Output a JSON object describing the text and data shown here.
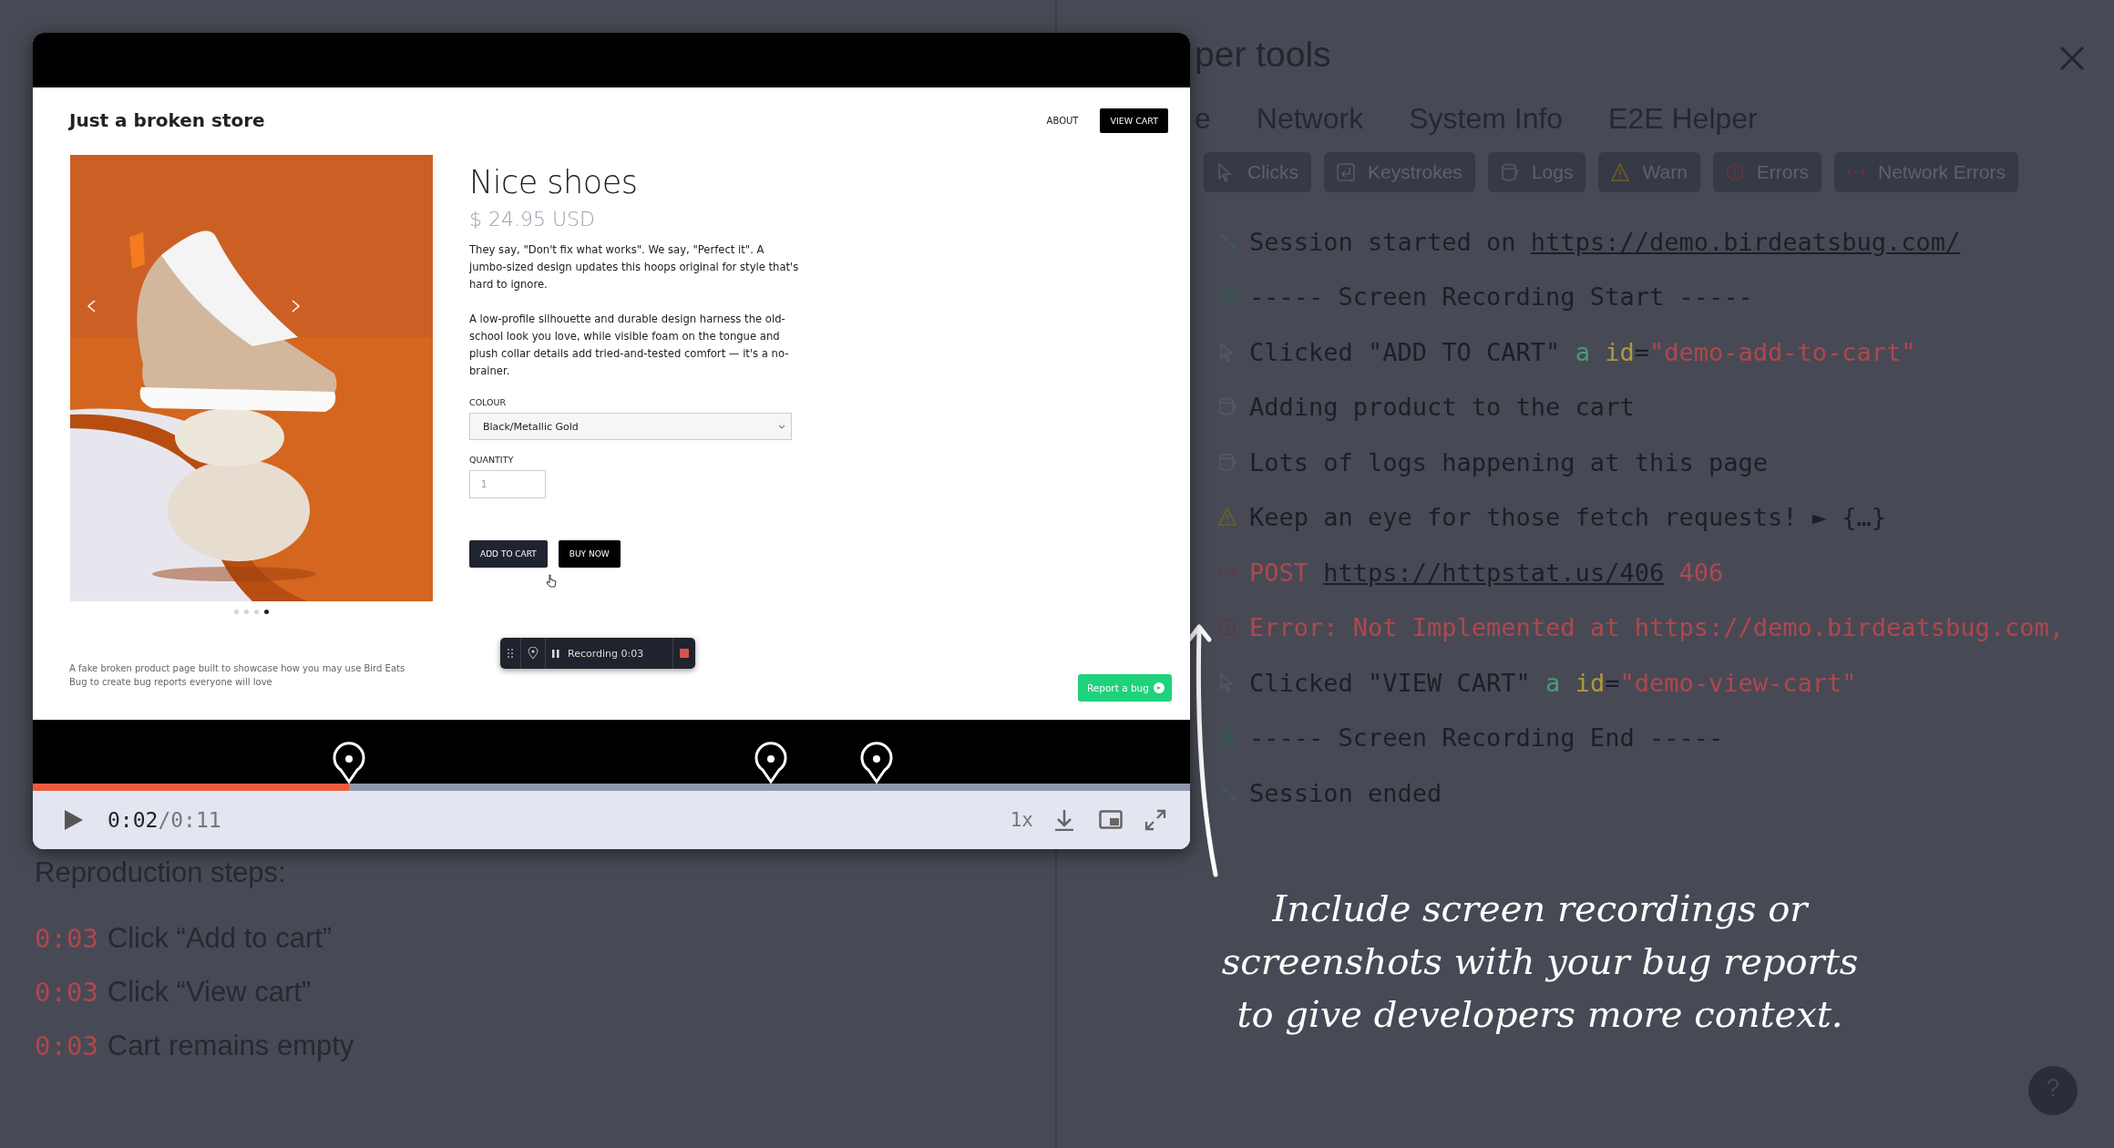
{
  "video": {
    "store": {
      "title": "Just a broken store",
      "nav": [
        {
          "label": "ABOUT",
          "kind": "link"
        },
        {
          "label": "VIEW CART",
          "kind": "button"
        }
      ],
      "product": {
        "name": "Nice shoes",
        "price": "$ 24.95 USD",
        "paragraphs": [
          "They say, \"Don't fix what works\". We say, \"Perfect it\". A jumbo-sized design updates this hoops original for style that's hard to ignore.",
          "A low-profile silhouette and durable design harness the old-school look you love, while visible foam on the tongue and plush collar details add tried-and-tested comfort — it's a no-brainer."
        ],
        "colour_label": "COLOUR",
        "colour_value": "Black/Metallic Gold",
        "quantity_label": "QUANTITY",
        "quantity_value": "1",
        "buttons": [
          {
            "label": "ADD TO CART",
            "kind": "secondary"
          },
          {
            "label": "BUY NOW",
            "kind": "primary"
          }
        ]
      },
      "carousel_dots": [
        {
          "selected": false
        },
        {
          "selected": false
        },
        {
          "selected": false
        },
        {
          "selected": true
        }
      ],
      "footer": "A fake broken product page built to showcase how you may use Bird Eats Bug to create bug reports everyone will love",
      "recorder": {
        "label": "Recording 0:03"
      },
      "report_button": "Report a bug"
    },
    "progress": {
      "level": 0.273
    },
    "time_current": "0:02",
    "time_total": "/0:11",
    "speed": "1x"
  },
  "left": {
    "heading": "Reproduction steps:",
    "steps": [
      {
        "time": "0:03",
        "text": "Click “Add to cart”"
      },
      {
        "time": "0:03",
        "text": "Click “View cart”"
      },
      {
        "time": "0:03",
        "text": "Cart remains empty"
      }
    ]
  },
  "dev_tools": {
    "title": "per tools",
    "tabs": [
      {
        "label": "e"
      },
      {
        "label": "Network"
      },
      {
        "label": "System Info"
      },
      {
        "label": "E2E Helper"
      }
    ],
    "filters": [
      {
        "label": "Clicks",
        "kind": "click"
      },
      {
        "label": "Keystrokes",
        "kind": "key"
      },
      {
        "label": "Logs",
        "kind": "log"
      },
      {
        "label": "Warn",
        "kind": "warn"
      },
      {
        "label": "Errors",
        "kind": "error"
      },
      {
        "label": "Network Errors",
        "kind": "network"
      }
    ],
    "logs": [
      {
        "kind": "session",
        "parts": [
          {
            "text": "Session started on ",
            "kind": "plain"
          },
          {
            "text": "https://demo.birdeatsbug.com/",
            "kind": "link"
          }
        ]
      },
      {
        "kind": "rec-start",
        "parts": [
          {
            "text": "----- Screen Recording Start -----",
            "kind": "plain"
          }
        ]
      },
      {
        "kind": "click",
        "parts": [
          {
            "text": "Clicked \"ADD TO CART\" ",
            "kind": "plain"
          },
          {
            "text": "a ",
            "kind": "tag"
          },
          {
            "text": "id",
            "kind": "attr"
          },
          {
            "text": "=",
            "kind": "plain"
          },
          {
            "text": "\"demo-add-to-cart\"",
            "kind": "string"
          }
        ]
      },
      {
        "kind": "log",
        "parts": [
          {
            "text": "Adding product to the cart",
            "kind": "plain"
          }
        ]
      },
      {
        "kind": "log",
        "parts": [
          {
            "text": "Lots of logs happening at this page",
            "kind": "plain"
          }
        ]
      },
      {
        "kind": "warn",
        "parts": [
          {
            "text": "Keep an eye for those fetch requests! ► {…}",
            "kind": "plain"
          }
        ]
      },
      {
        "kind": "network",
        "parts": [
          {
            "text": "POST ",
            "kind": "error"
          },
          {
            "text": "https://httpstat.us/406",
            "kind": "link"
          },
          {
            "text": " 406",
            "kind": "error"
          }
        ]
      },
      {
        "kind": "error",
        "parts": [
          {
            "text": "Error: Not Implemented at https://demo.birdeatsbug.com,",
            "kind": "error"
          }
        ]
      },
      {
        "kind": "click",
        "parts": [
          {
            "text": "Clicked \"VIEW CART\" ",
            "kind": "plain"
          },
          {
            "text": "a ",
            "kind": "tag"
          },
          {
            "text": "id",
            "kind": "attr"
          },
          {
            "text": "=",
            "kind": "plain"
          },
          {
            "text": "\"demo-view-cart\"",
            "kind": "string"
          }
        ]
      },
      {
        "kind": "rec-end",
        "parts": [
          {
            "text": "----- Screen Recording End -----",
            "kind": "plain"
          }
        ]
      },
      {
        "kind": "session",
        "parts": [
          {
            "text": "Session ended",
            "kind": "plain"
          }
        ]
      }
    ]
  },
  "caption": [
    "Include screen recordings or",
    "screenshots with your bug reports",
    "to give developers more context."
  ]
}
